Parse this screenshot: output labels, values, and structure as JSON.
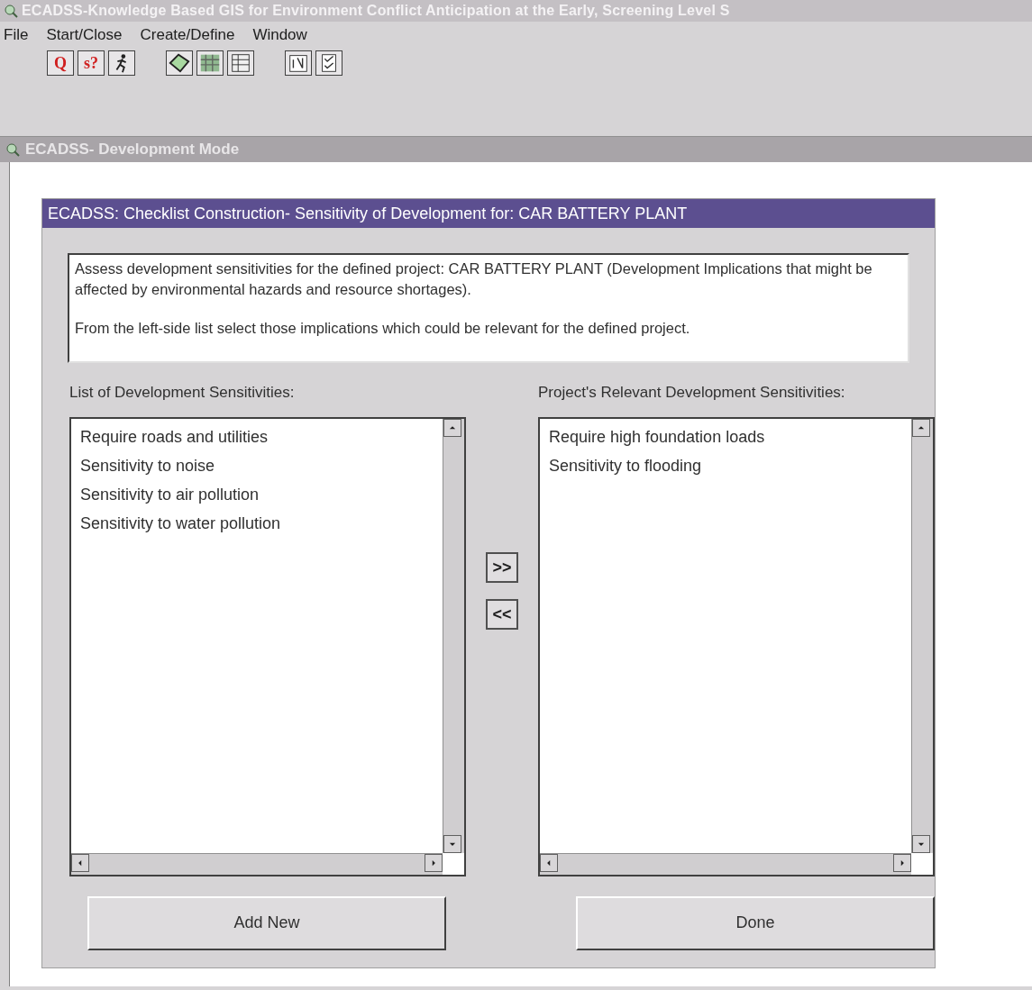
{
  "app_window": {
    "title": "ECADSS-Knowledge Based GIS for Environment Conflict Anticipation at the Early, Screening Level S"
  },
  "menu": [
    "File",
    "Start/Close",
    "Create/Define",
    "Window"
  ],
  "toolbar": [
    {
      "kind": "text",
      "label": "Q"
    },
    {
      "kind": "text",
      "label": "s?"
    },
    {
      "kind": "runner"
    },
    {
      "kind": "gap"
    },
    {
      "kind": "polygon"
    },
    {
      "kind": "map"
    },
    {
      "kind": "grid"
    },
    {
      "kind": "gap"
    },
    {
      "kind": "notepad"
    },
    {
      "kind": "checklist"
    }
  ],
  "child_window": {
    "title": "ECADSS- Development Mode"
  },
  "dialog": {
    "title": "ECADSS: Checklist Construction- Sensitivity of Development for: CAR BATTERY PLANT",
    "instructions": [
      "Assess development sensitivities for the defined project: CAR BATTERY PLANT (Development Implications that might be affected by environmental hazards and resource shortages).",
      "From the left-side list select those implications which could be relevant for the defined project."
    ],
    "left_list": {
      "label": "List of Development Sensitivities:",
      "items": [
        "Require roads and utilities",
        "Sensitivity to noise",
        "Sensitivity to air pollution",
        "Sensitivity to water pollution"
      ]
    },
    "move_buttons": [
      ">>",
      "<<"
    ],
    "right_list": {
      "label": "Project's Relevant Development Sensitivities:",
      "items": [
        "Require high foundation loads",
        "Sensitivity to flooding"
      ]
    },
    "buttons": [
      "Add New",
      "Done"
    ]
  }
}
